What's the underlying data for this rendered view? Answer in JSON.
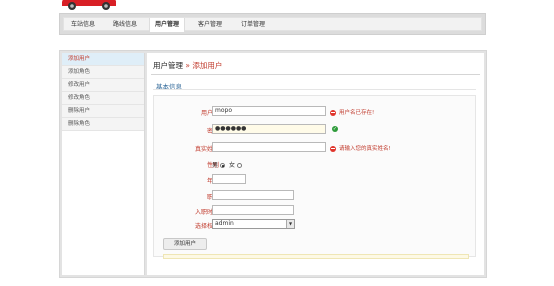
{
  "top_nav": {
    "tabs": [
      {
        "label": "车站信息"
      },
      {
        "label": "路线信息"
      },
      {
        "label": "用户管理"
      },
      {
        "label": "客户管理"
      },
      {
        "label": "订单管理"
      }
    ],
    "active_index": 2
  },
  "sidebar": {
    "items": [
      {
        "label": "添加用户"
      },
      {
        "label": "添加角色"
      },
      {
        "label": "修改用户"
      },
      {
        "label": "修改角色"
      },
      {
        "label": "删除用户"
      },
      {
        "label": "删除角色"
      }
    ],
    "active_index": 0
  },
  "breadcrumb": {
    "parent": "用户管理",
    "separator": "»",
    "current": "添加用户"
  },
  "form": {
    "section_title": "基本信息",
    "username": {
      "label": "用户名",
      "value": "mopo",
      "error": "用户名已存在!"
    },
    "password": {
      "label": "密码",
      "value": "●●●●●●"
    },
    "realname": {
      "label": "真实姓名",
      "value": "",
      "error": "请输入您的真实姓名!"
    },
    "gender": {
      "label": "性别",
      "male": "男",
      "female": "女",
      "selected": "male"
    },
    "age": {
      "label": "年龄",
      "value": ""
    },
    "position": {
      "label": "职位",
      "value": ""
    },
    "hire_date": {
      "label": "入职时间",
      "value": ""
    },
    "role": {
      "label": "选择权限",
      "value": "admin"
    },
    "submit_label": "添加用户"
  },
  "colors": {
    "label_red": "#c0392b",
    "title_blue": "#2a6496",
    "ok_green": "#2e9b3a",
    "error_red": "#e0342b"
  }
}
